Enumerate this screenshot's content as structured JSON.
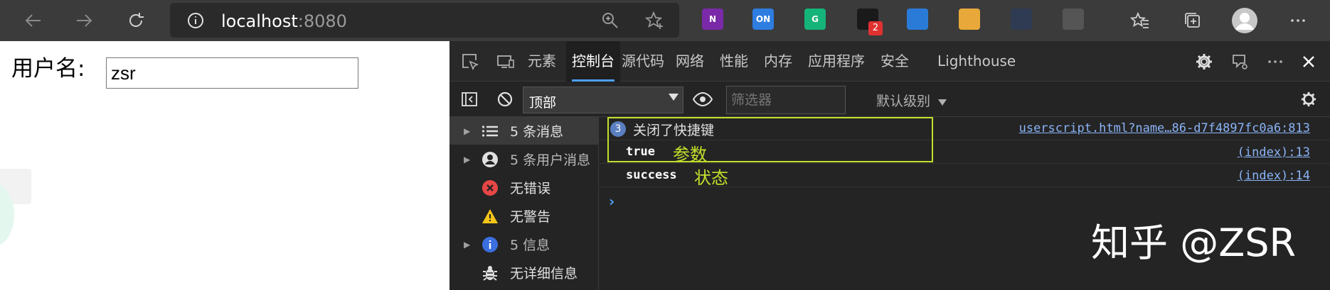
{
  "browser": {
    "address": {
      "host": "localhost",
      "port": ":8080"
    },
    "extensions": [
      {
        "name": "onenote",
        "text": "N",
        "bg": "#7a2aa8",
        "fg": "#ffffff"
      },
      {
        "name": "on-toggle",
        "text": "ON",
        "bg": "#2e7de0",
        "fg": "#ffffff"
      },
      {
        "name": "grammarly",
        "text": "G",
        "bg": "#15b47a",
        "fg": "#ffffff"
      },
      {
        "name": "ext-badge",
        "text": "",
        "badge": "2",
        "bg": "#1a1a1a",
        "fg": "#ffffff"
      },
      {
        "name": "cloud-ext",
        "text": "",
        "bg": "#2a7bd8",
        "fg": "#ffffff"
      },
      {
        "name": "colorful-ext",
        "text": "",
        "bg": "#e8a93a",
        "fg": "#ffffff"
      },
      {
        "name": "sync-ext",
        "text": "",
        "bg": "#2f3b52",
        "fg": "#ffffff"
      },
      {
        "name": "link-ext",
        "text": "",
        "bg": "#555555",
        "fg": "#ffffff"
      }
    ]
  },
  "page": {
    "username_label": "用户名:",
    "username_value": "zsr"
  },
  "devtools": {
    "tabs": [
      {
        "label": "元素"
      },
      {
        "label": "控制台",
        "active": true
      },
      {
        "label": "源代码"
      },
      {
        "label": "网络"
      },
      {
        "label": "性能"
      },
      {
        "label": "内存"
      },
      {
        "label": "应用程序"
      },
      {
        "label": "安全"
      },
      {
        "label": "Lighthouse"
      }
    ],
    "context_select": "顶部",
    "filter_placeholder": "筛选器",
    "level_label": "默认级别",
    "sidebar": [
      {
        "label": "5 条消息",
        "icon": "list-icon",
        "expandable": true,
        "selected": true
      },
      {
        "label": "5 条用户消息",
        "icon": "user-icon",
        "expandable": true
      },
      {
        "label": "无错误",
        "icon": "error-icon"
      },
      {
        "label": "无警告",
        "icon": "warning-icon"
      },
      {
        "label": "5 信息",
        "icon": "info-icon",
        "expandable": true
      },
      {
        "label": "无详细信息",
        "icon": "bug-icon"
      }
    ],
    "console": {
      "messages": [
        {
          "badge": "3",
          "text": "关闭了快捷键",
          "source": "userscript.html?name…86-d7f4897fc0a6:813"
        },
        {
          "text": "true",
          "annotation": "参数",
          "source": "(index):13"
        },
        {
          "text": "success",
          "annotation": "状态",
          "source": "(index):14"
        }
      ]
    },
    "colors": {
      "accent": "#4d9ff8",
      "highlight_box": "#c3e02c"
    }
  },
  "watermark": "知乎 @ZSR"
}
